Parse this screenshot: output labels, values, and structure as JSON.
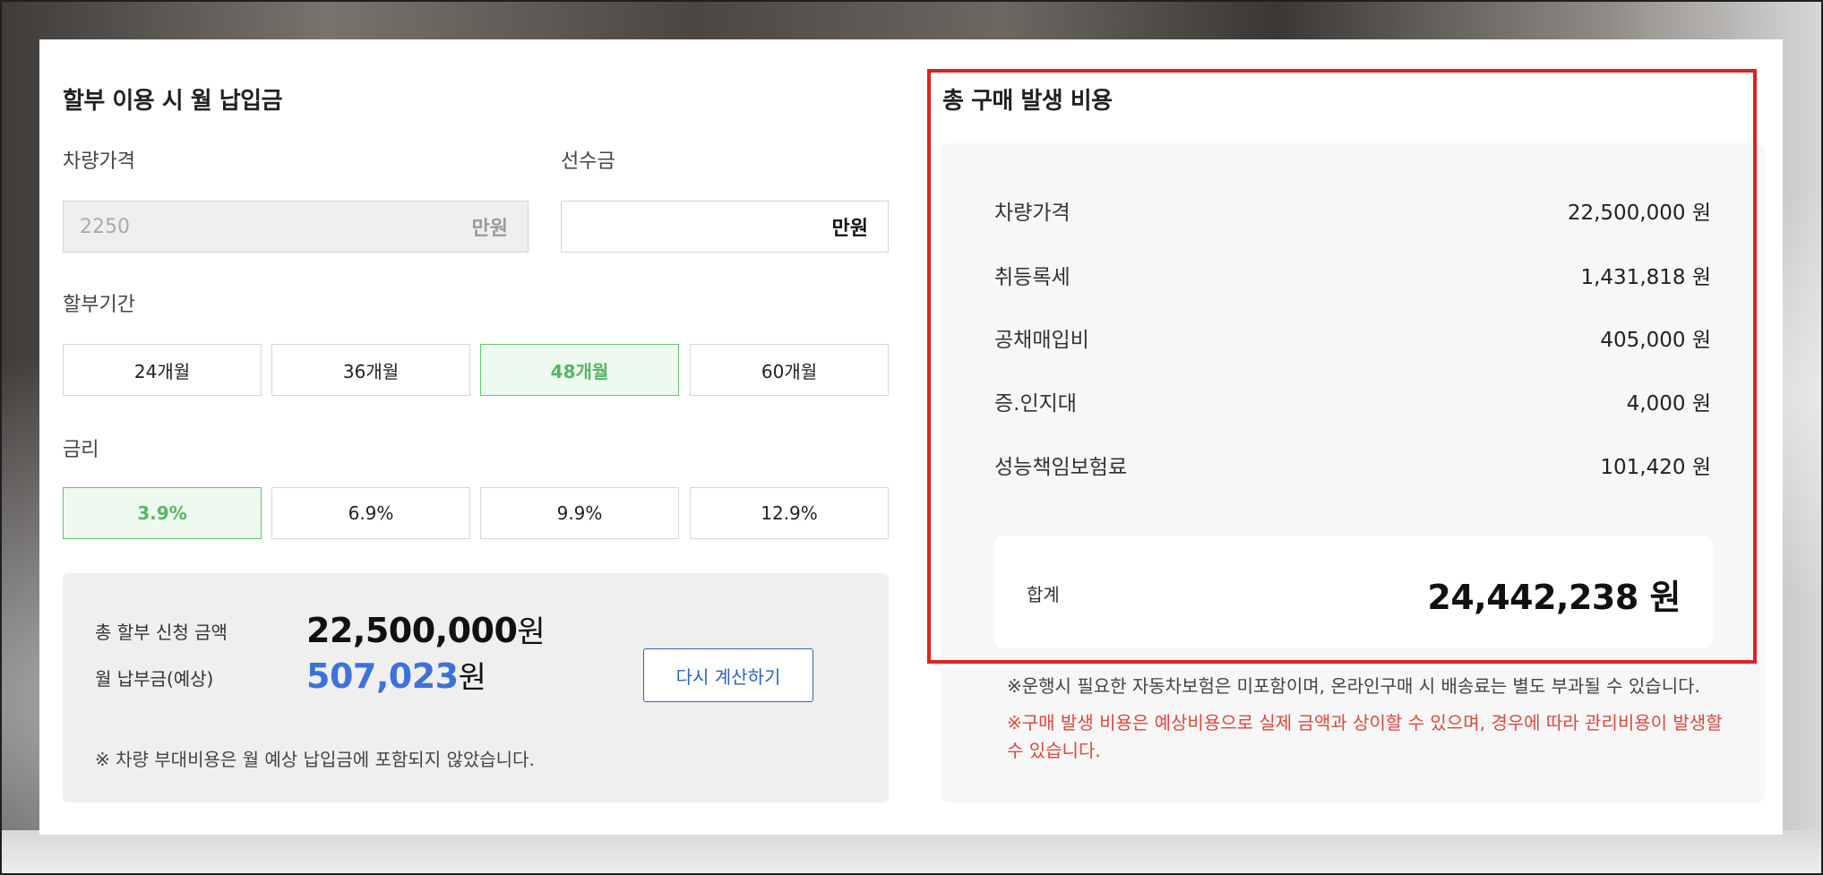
{
  "installment": {
    "title": "할부 이용 시 월 납입금",
    "vehicle_price_label": "차량가격",
    "vehicle_price_value": "2250",
    "vehicle_price_unit": "만원",
    "down_payment_label": "선수금",
    "down_payment_value": "",
    "down_payment_unit": "만원",
    "period_label": "할부기간",
    "period_options": [
      "24개월",
      "36개월",
      "48개월",
      "60개월"
    ],
    "period_selected": "48개월",
    "rate_label": "금리",
    "rate_options": [
      "3.9%",
      "6.9%",
      "9.9%",
      "12.9%"
    ],
    "rate_selected": "3.9%",
    "summary": {
      "total_label": "총 할부 신청 금액",
      "total_amount": "22,500,000",
      "total_unit": "원",
      "monthly_label": "월 납부금(예상)",
      "monthly_amount": "507,023",
      "monthly_unit": "원",
      "recalc_button": "다시 계산하기",
      "note": "※ 차량 부대비용은 월 예상 납입금에 포함되지 않았습니다."
    }
  },
  "costs": {
    "title": "총 구매 발생 비용",
    "rows": [
      {
        "label": "차량가격",
        "value": "22,500,000 원"
      },
      {
        "label": "취등록세",
        "value": "1,431,818 원"
      },
      {
        "label": "공채매입비",
        "value": "405,000 원"
      },
      {
        "label": "증.인지대",
        "value": "4,000 원"
      },
      {
        "label": "성능책임보험료",
        "value": "101,420 원"
      }
    ],
    "total_label": "합계",
    "total_value": "24,442,238 원",
    "footnote1": "※운행시 필요한 자동차보험은 미포함이며, 온라인구매 시 배송료는 별도 부과될 수 있습니다.",
    "footnote2": "※구매 발생 비용은 예상비용으로 실제 금액과 상이할 수 있으며, 경우에 따라 관리비용이 발생할 수 있습니다."
  },
  "colors": {
    "selected_green": "#55b862",
    "accent_blue": "#3d72d9",
    "button_blue": "#2e62c7",
    "warning_red": "#e0463b",
    "highlight_red": "#e01f1f"
  }
}
